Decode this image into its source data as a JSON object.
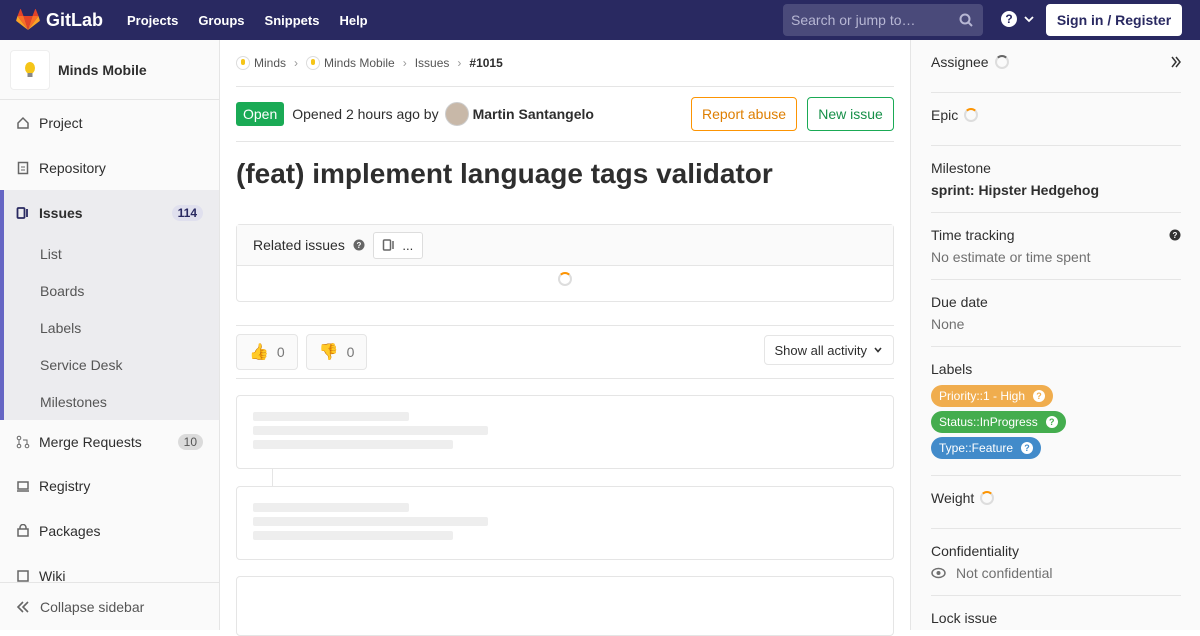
{
  "topbar": {
    "brand": "GitLab",
    "nav": [
      "Projects",
      "Groups",
      "Snippets",
      "Help"
    ],
    "search_placeholder": "Search or jump to…",
    "signin": "Sign in / Register"
  },
  "sidebar": {
    "project_name": "Minds Mobile",
    "items": [
      {
        "label": "Project"
      },
      {
        "label": "Repository"
      },
      {
        "label": "Issues",
        "count": "114"
      },
      {
        "label": "Merge Requests",
        "count": "10"
      },
      {
        "label": "Registry"
      },
      {
        "label": "Packages"
      },
      {
        "label": "Wiki"
      }
    ],
    "issues_sub": [
      "List",
      "Boards",
      "Labels",
      "Service Desk",
      "Milestones"
    ],
    "collapse": "Collapse sidebar"
  },
  "breadcrumb": [
    "Minds",
    "Minds Mobile",
    "Issues",
    "#1015"
  ],
  "issue": {
    "status": "Open",
    "opened_text": "Opened 2 hours ago by",
    "author": "Martin Santangelo",
    "report_abuse": "Report abuse",
    "new_issue": "New issue",
    "title": "(feat) implement language tags validator",
    "related_label": "Related issues",
    "related_count": "...",
    "thumbs_up": "0",
    "thumbs_down": "0",
    "activity_filter": "Show all activity"
  },
  "right": {
    "assignee": "Assignee",
    "epic": "Epic",
    "milestone": "Milestone",
    "milestone_value": "sprint: Hipster Hedgehog",
    "time_tracking": "Time tracking",
    "time_value": "No estimate or time spent",
    "due_date": "Due date",
    "due_value": "None",
    "labels": "Labels",
    "label_list": [
      {
        "text": "Priority::1 - High",
        "color": "#f0ad4e"
      },
      {
        "text": "Status::InProgress",
        "color": "#44ad4e"
      },
      {
        "text": "Type::Feature",
        "color": "#428bca"
      }
    ],
    "weight": "Weight",
    "confidentiality": "Confidentiality",
    "confidential_value": "Not confidential",
    "lock": "Lock issue"
  }
}
